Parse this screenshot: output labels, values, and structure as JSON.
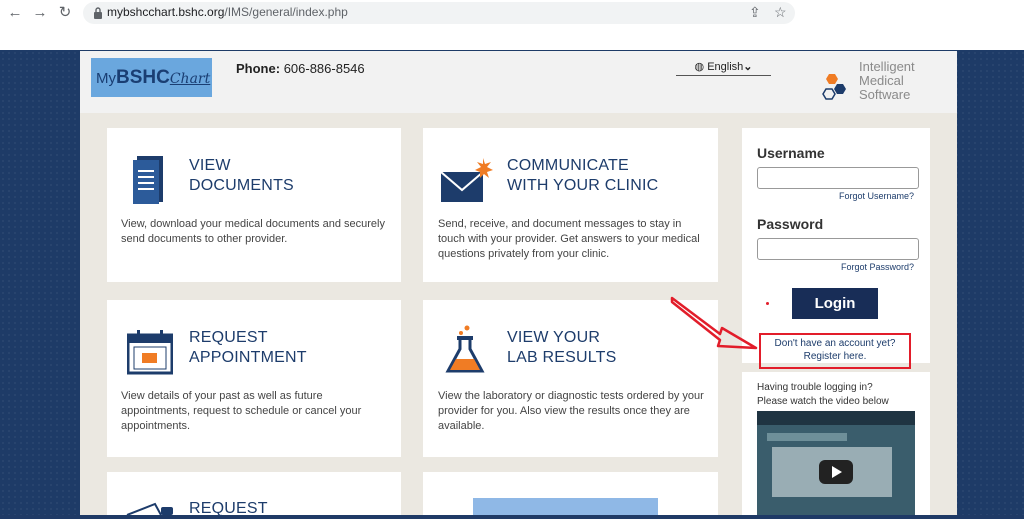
{
  "browser": {
    "url_host": "mybshcchart.bshc.org",
    "url_path": "/IMS/general/index.php",
    "back_icon": "arrow-left-icon",
    "forward_icon": "arrow-right-icon",
    "reload_icon": "reload-icon",
    "share_icon": "share-icon",
    "bookmark_icon": "star-icon"
  },
  "header": {
    "logo_my": "My",
    "logo_bshc": "BSHC",
    "logo_chart": "Chart",
    "phone_label": "Phone:",
    "phone_number": "606-886-8546",
    "language": "English",
    "vendor_line1": "Intelligent",
    "vendor_line2": "Medical",
    "vendor_line3": "Software"
  },
  "cards": [
    {
      "title1": "VIEW",
      "title2": "DOCUMENTS",
      "desc": "View, download your medical documents and securely send documents to other provider."
    },
    {
      "title1": "COMMUNICATE",
      "title2": "WITH YOUR CLINIC",
      "desc": "Send, receive, and document messages to stay in touch with your provider. Get answers to your medical questions privately from your clinic."
    },
    {
      "title1": "REQUEST",
      "title2": "APPOINTMENT",
      "desc": "View details of your past as well as future appointments, request to schedule or cancel your appointments."
    },
    {
      "title1": "VIEW YOUR",
      "title2": "LAB RESULTS",
      "desc": "View the laboratory or diagnostic tests ordered by your provider for you. Also view the results once they are available."
    },
    {
      "title1": "REQUEST"
    }
  ],
  "login": {
    "username_label": "Username",
    "forgot_username": "Forgot Username?",
    "password_label": "Password",
    "forgot_password": "Forgot Password?",
    "login_button": "Login",
    "register_line1": "Don't have an account yet?",
    "register_line2": "Register here."
  },
  "help": {
    "line1": "Having trouble logging in?",
    "line2": "Please watch the video below"
  },
  "colors": {
    "accent": "#1d3c6b",
    "annotation": "#e21d2a",
    "lab_orange": "#f07c24"
  }
}
